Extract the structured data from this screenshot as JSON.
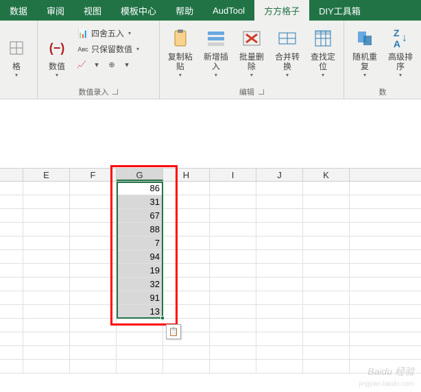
{
  "tabs": {
    "data": "数据",
    "review": "审阅",
    "view": "视图",
    "template": "模板中心",
    "help": "帮助",
    "audtool": "AudTool",
    "fangfang": "方方格子",
    "diy": "DIY工具箱"
  },
  "ribbon": {
    "group0": {
      "label": "格"
    },
    "numeric_group": {
      "shuzhi": "数值",
      "round": "四舍五入",
      "keep_num": "只保留数值",
      "label": "数值录入"
    },
    "edit_group": {
      "copy_paste": "复制粘\n贴",
      "insert": "新增插\n入",
      "batch_del": "批量删\n除",
      "merge": "合并转\n换",
      "find": "查找定\n位",
      "label": "编辑"
    },
    "right_group": {
      "random": "随机重\n复",
      "sort": "高级排\n序",
      "label": "数"
    }
  },
  "columns": [
    "E",
    "F",
    "G",
    "H",
    "I",
    "J",
    "K"
  ],
  "g_values": [
    86,
    31,
    67,
    88,
    7,
    94,
    19,
    32,
    91,
    13
  ],
  "watermark": "Baidu 经验",
  "watermark2": "jingyan.baidu.com"
}
